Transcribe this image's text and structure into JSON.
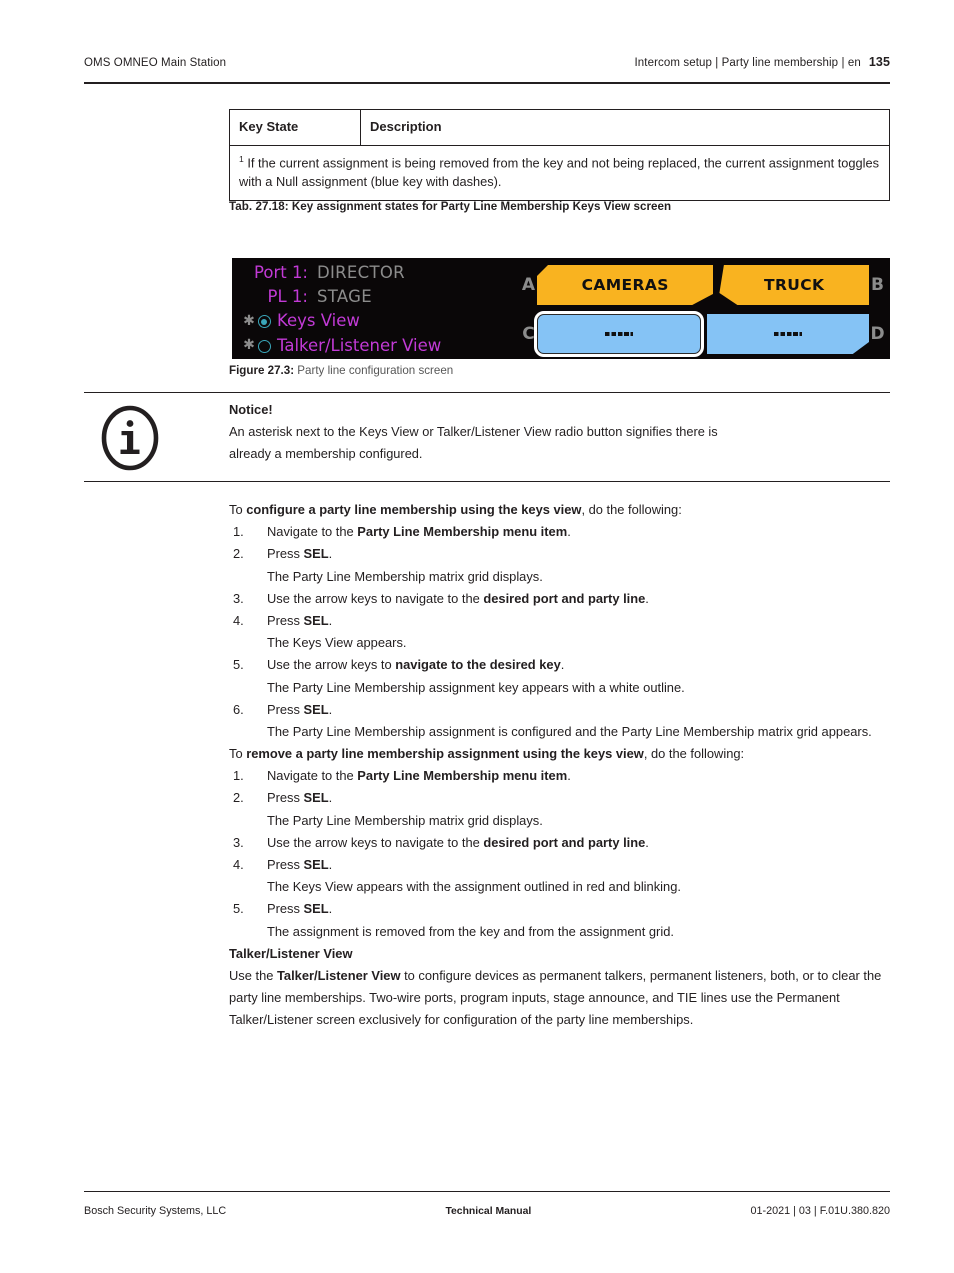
{
  "header": {
    "left": "OMS OMNEO Main Station",
    "breadcrumb": "Intercom setup | Party line membership | en",
    "page_number": "135"
  },
  "table": {
    "columns": [
      "Key State",
      "Description"
    ],
    "footnote_marker": "1",
    "footnote_line1": " If the current assignment is being removed from the key and not being replaced, the",
    "footnote_line2": "current assignment toggles with a Null assignment (blue key with dashes).",
    "caption": "Tab. 27.18: Key assignment states for Party Line Membership Keys View screen"
  },
  "figure": {
    "caption_label": "Figure 27.3:",
    "caption_text": " Party line configuration screen",
    "screen": {
      "rows": [
        {
          "label": "Port 1:",
          "value": "DIRECTOR"
        },
        {
          "label": "PL 1:",
          "value": "STAGE"
        }
      ],
      "options": [
        {
          "asterisk": "★",
          "label": "Keys View",
          "selected": true
        },
        {
          "asterisk": "★",
          "label": "Talker/Listener View",
          "selected": false
        }
      ],
      "keys": [
        {
          "side": "A",
          "label": "CAMERAS",
          "color": "#f9b320",
          "state": "assigned"
        },
        {
          "side": "B",
          "label": "TRUCK",
          "color": "#f9b320",
          "state": "assigned"
        },
        {
          "side": "C",
          "label": "----",
          "color": "#85c3f5",
          "state": "null-selected"
        },
        {
          "side": "D",
          "label": "----",
          "color": "#85c3f5",
          "state": "null"
        }
      ],
      "colors": {
        "background": "#0a0708",
        "label": "#c23ad6",
        "value": "#8c8c8c",
        "radio": "#3aa6b9",
        "amber_key": "#f9b320",
        "blue_key": "#85c3f5",
        "selection_outline": "#ffffff"
      }
    }
  },
  "notice": {
    "icon": "info-icon",
    "title": "Notice!",
    "line1": "An asterisk next to the Keys View or Talker/Listener View radio button signifies there is",
    "line2": "already a membership configured."
  },
  "content": {
    "configure": {
      "lead_prefix": "To ",
      "lead_bold": "configure a party line membership using the keys view",
      "lead_suffix": ", do the following:",
      "steps": [
        {
          "num": "1.",
          "pre": "Navigate to the ",
          "bold": "Party Line Membership menu item",
          "post": "."
        },
        {
          "num": "2.",
          "pre": "Press ",
          "bold": "SEL",
          "post": ".",
          "sub": "The Party Line Membership matrix grid displays."
        },
        {
          "num": "3.",
          "pre": "Use the arrow keys to navigate to the ",
          "bold": "desired port and party line",
          "post": "."
        },
        {
          "num": "4.",
          "pre": "Press ",
          "bold": "SEL",
          "post": ".",
          "sub": "The Keys View appears."
        },
        {
          "num": "5.",
          "pre": "Use the arrow keys to ",
          "bold": "navigate to the desired key",
          "post": ".",
          "sub": "The Party Line Membership assignment key appears with a white outline."
        },
        {
          "num": "6.",
          "pre": "Press ",
          "bold": "SEL",
          "post": ".",
          "sub": "The Party Line Membership assignment is configured and the Party Line Membership matrix grid appears."
        }
      ]
    },
    "remove": {
      "lead_prefix": "To ",
      "lead_bold": "remove a party line membership assignment using the keys view",
      "lead_suffix": ", do the following:",
      "steps": [
        {
          "num": "1.",
          "pre": "Navigate to the ",
          "bold": "Party Line Membership menu item",
          "post": "."
        },
        {
          "num": "2.",
          "pre": "Press ",
          "bold": "SEL",
          "post": ".",
          "sub": "The Party Line Membership matrix grid displays."
        },
        {
          "num": "3.",
          "pre": "Use the arrow keys to navigate to the ",
          "bold": "desired port and party line",
          "post": "."
        },
        {
          "num": "4.",
          "pre": "Press ",
          "bold": "SEL",
          "post": ".",
          "sub": "The Keys View appears with the assignment outlined in red and blinking."
        },
        {
          "num": "5.",
          "pre": "Press ",
          "bold": "SEL",
          "post": ".",
          "sub": "The assignment is removed from the key and from the assignment grid."
        }
      ]
    },
    "talker_section": {
      "heading": "Talker/Listener View",
      "body_pre": "Use the ",
      "body_bold": "Talker/Listener View",
      "body_post": " to configure devices as permanent talkers, permanent listeners, both, or to clear the party line memberships. Two-wire ports, program inputs, stage announce, and TIE lines use the Permanent Talker/Listener screen exclusively for configuration of the party line memberships."
    }
  },
  "footer": {
    "left": "Bosch Security Systems, LLC",
    "middle": "Technical Manual",
    "right": "01-2021 | 03 | F.01U.380.820"
  }
}
